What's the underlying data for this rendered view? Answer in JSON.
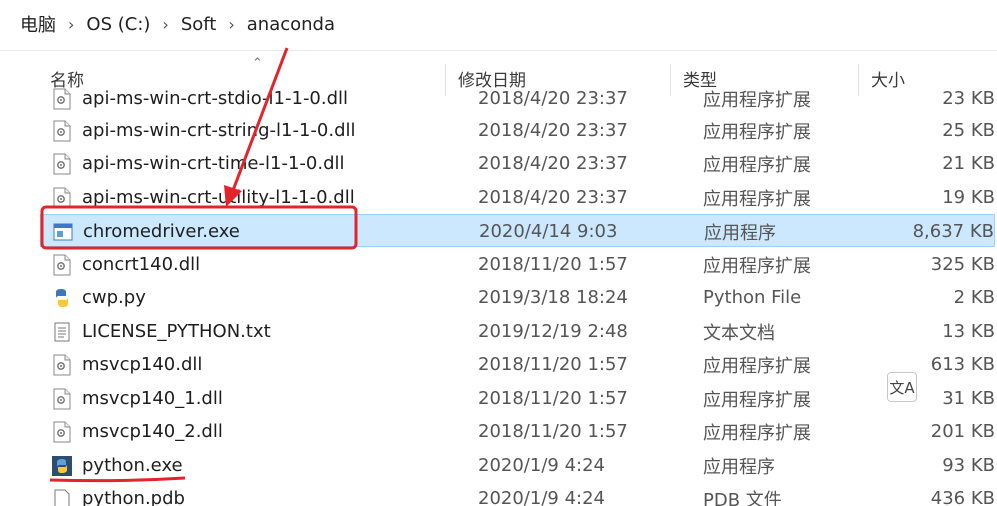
{
  "breadcrumb": [
    "电脑",
    "OS (C:)",
    "Soft",
    "anaconda"
  ],
  "header": {
    "name": "名称",
    "date": "修改日期",
    "type": "类型",
    "size": "大小"
  },
  "rows": [
    {
      "icon": "dll-file-icon",
      "name": "api-ms-win-crt-stdio-l1-1-0.dll",
      "date": "2018/4/20 23:37",
      "type": "应用程序扩展",
      "size": "23 KB"
    },
    {
      "icon": "dll-file-icon",
      "name": "api-ms-win-crt-string-l1-1-0.dll",
      "date": "2018/4/20 23:37",
      "type": "应用程序扩展",
      "size": "25 KB"
    },
    {
      "icon": "dll-file-icon",
      "name": "api-ms-win-crt-time-l1-1-0.dll",
      "date": "2018/4/20 23:37",
      "type": "应用程序扩展",
      "size": "21 KB"
    },
    {
      "icon": "dll-file-icon",
      "name": "api-ms-win-crt-utility-l1-1-0.dll",
      "date": "2018/4/20 23:37",
      "type": "应用程序扩展",
      "size": "19 KB"
    },
    {
      "icon": "exe-app-icon",
      "name": "chromedriver.exe",
      "date": "2020/4/14 9:03",
      "type": "应用程序",
      "size": "8,637 KB",
      "selected": true
    },
    {
      "icon": "dll-file-icon",
      "name": "concrt140.dll",
      "date": "2018/11/20 1:57",
      "type": "应用程序扩展",
      "size": "325 KB"
    },
    {
      "icon": "python-file-icon",
      "name": "cwp.py",
      "date": "2019/3/18 18:24",
      "type": "Python File",
      "size": "2 KB"
    },
    {
      "icon": "text-file-icon",
      "name": "LICENSE_PYTHON.txt",
      "date": "2019/12/19 2:48",
      "type": "文本文档",
      "size": "13 KB"
    },
    {
      "icon": "dll-file-icon",
      "name": "msvcp140.dll",
      "date": "2018/11/20 1:57",
      "type": "应用程序扩展",
      "size": "613 KB"
    },
    {
      "icon": "dll-file-icon",
      "name": "msvcp140_1.dll",
      "date": "2018/11/20 1:57",
      "type": "应用程序扩展",
      "size": "31 KB"
    },
    {
      "icon": "dll-file-icon",
      "name": "msvcp140_2.dll",
      "date": "2018/11/20 1:57",
      "type": "应用程序扩展",
      "size": "201 KB"
    },
    {
      "icon": "python-exe-icon",
      "name": "python.exe",
      "date": "2020/1/9 4:24",
      "type": "应用程序",
      "size": "93 KB"
    },
    {
      "icon": "blank-file-icon",
      "name": "python.pdb",
      "date": "2020/1/9 4:24",
      "type": "PDB 文件",
      "size": "436 KB"
    }
  ],
  "translate_badge": "文A",
  "colors": {
    "annotation_red": "#e3242b",
    "selection_bg": "#cce8ff",
    "selection_border": "#99d1ff"
  }
}
